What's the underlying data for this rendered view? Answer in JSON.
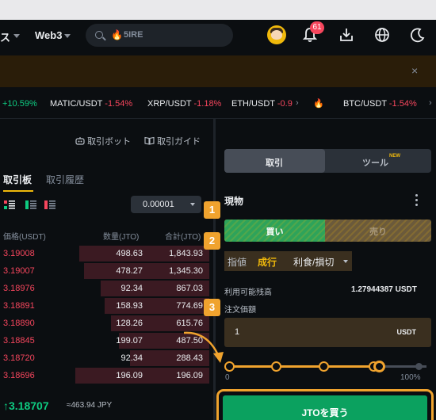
{
  "nav": {
    "menu_partial": "ス",
    "web3": "Web3",
    "search_text": "5IRE",
    "notifications": "61"
  },
  "banner": {
    "close": "×"
  },
  "ticker": [
    {
      "symbol": "",
      "change": "+10.59%",
      "dir": "up"
    },
    {
      "symbol": "MATIC/USDT",
      "change": "-1.54%",
      "dir": "down"
    },
    {
      "symbol": "XRP/USDT",
      "change": "-1.18%",
      "dir": "down"
    },
    {
      "symbol": "ETH/USDT",
      "change": "-0.9",
      "dir": "down"
    },
    {
      "symbol": "BTC/USDT",
      "change": "-1.54%",
      "dir": "down"
    }
  ],
  "book": {
    "bot_label": "取引ボット",
    "guide_label": "取引ガイド",
    "tab_active": "取引板",
    "tab_history": "取引履歴",
    "precision": "0.00001",
    "col_price": "価格(USDT)",
    "col_qty": "数量(JTO)",
    "col_total": "合計(JTO)",
    "rows": [
      {
        "price": "3.19008",
        "qty": "498.63",
        "total": "1,843.93",
        "depth": 0.62
      },
      {
        "price": "3.19007",
        "qty": "478.27",
        "total": "1,345.30",
        "depth": 0.6
      },
      {
        "price": "3.18976",
        "qty": "92.34",
        "total": "867.03",
        "depth": 0.52
      },
      {
        "price": "3.18891",
        "qty": "158.93",
        "total": "774.69",
        "depth": 0.5
      },
      {
        "price": "3.18890",
        "qty": "128.26",
        "total": "615.76",
        "depth": 0.47
      },
      {
        "price": "3.18845",
        "qty": "199.07",
        "total": "487.50",
        "depth": 0.43
      },
      {
        "price": "3.18720",
        "qty": "92.34",
        "total": "288.43",
        "depth": 0.38
      },
      {
        "price": "3.18696",
        "qty": "196.09",
        "total": "196.09",
        "depth": 0.64
      }
    ],
    "last_price": "↑3.18707",
    "last_jpy": "≈463.94 JPY"
  },
  "trade": {
    "seg_trade": "取引",
    "seg_tools": "ツール",
    "seg_new": "NEW",
    "spot": "現物",
    "buy": "買い",
    "sell": "売り",
    "order_limit": "指値",
    "order_market": "成行",
    "order_stop": "利食/損切",
    "avail_label": "利用可能残高",
    "avail_value": "1.27944387 USDT",
    "price_label": "注文価額",
    "price_value": "1",
    "price_unit": "USDT",
    "slider_min": "0",
    "slider_max": "100%",
    "slider_value_percent": 80,
    "buy_button": "JTOを買う"
  },
  "steps": [
    "1",
    "2",
    "3"
  ],
  "colors": {
    "accent": "#f0a32e",
    "up": "#0ecb81",
    "down": "#f6465d",
    "buy": "#0ba15f"
  }
}
